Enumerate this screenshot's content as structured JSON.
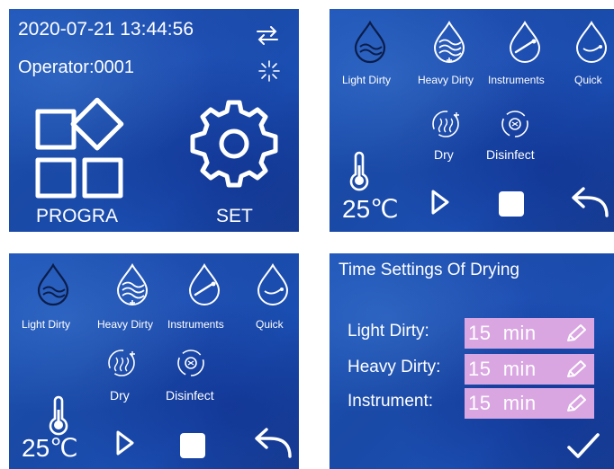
{
  "home": {
    "datetime": "2020-07-21 13:44:56",
    "operator_label": "Operator",
    "operator_sep": ":",
    "operator_value": "0001",
    "program_label": "PROGRA",
    "set_label": "SET",
    "icons": [
      "swap-icon",
      "sun-icon",
      "programs-icon",
      "settings-gear-icon"
    ]
  },
  "programs_screen": {
    "programs": [
      {
        "label": "Light Dirty",
        "icon": "light-dirty-icon"
      },
      {
        "label": "Heavy Dirty",
        "icon": "heavy-dirty-icon"
      },
      {
        "label": "Instruments",
        "icon": "instruments-icon"
      },
      {
        "label": "Quick",
        "icon": "quick-icon"
      },
      {
        "label": "Dry",
        "icon": "dry-icon"
      },
      {
        "label": "Disinfect",
        "icon": "disinfect-icon"
      }
    ],
    "temperature": "25℃",
    "controls": [
      "play-icon",
      "stop-icon",
      "back-icon"
    ]
  },
  "drying_settings": {
    "title": "Time Settings Of Drying",
    "rows": [
      {
        "label": "Light Dirty:",
        "value": "15  min"
      },
      {
        "label": "Heavy Dirty:",
        "value": "15  min"
      },
      {
        "label": "Instrument:",
        "value": "15  min"
      }
    ],
    "confirm_icon": "check-icon"
  }
}
